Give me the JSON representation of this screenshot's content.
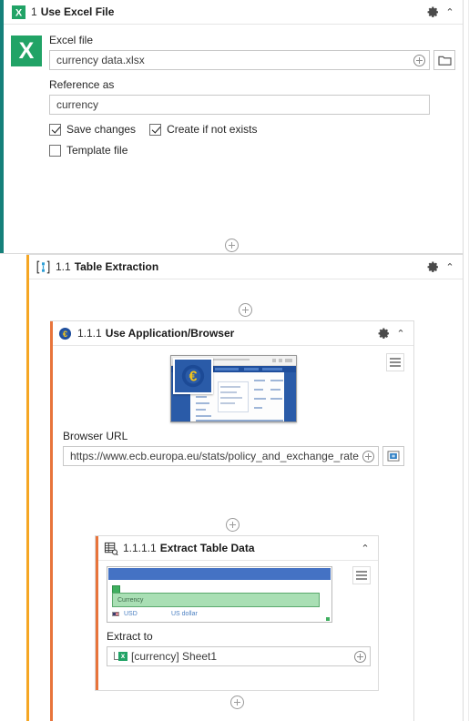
{
  "workflow": {
    "activities": [
      {
        "number": "1",
        "title": "Use Excel File",
        "icon": "excel-icon",
        "rail_color": "#15807a",
        "fields": {
          "excel_file_label": "Excel file",
          "excel_file_value": "currency data.xlsx",
          "reference_as_label": "Reference as",
          "reference_as_value": "currency"
        },
        "checkboxes": [
          {
            "label": "Save changes",
            "checked": true
          },
          {
            "label": "Create if not exists",
            "checked": true
          },
          {
            "label": "Template file",
            "checked": false
          }
        ]
      },
      {
        "number": "1.1",
        "title": "Table Extraction",
        "icon": "table-extraction-icon",
        "rail_color": "#f5a623"
      },
      {
        "number": "1.1.1",
        "title": "Use Application/Browser",
        "icon": "browser-euro-icon",
        "rail_color": "#e8743b",
        "fields": {
          "browser_url_label": "Browser URL",
          "browser_url_value": "https://www.ecb.europa.eu/stats/policy_and_exchange_rates ..."
        }
      },
      {
        "number": "1.1.1.1",
        "title": "Extract Table Data",
        "icon": "extract-table-icon",
        "rail_color": "#e8743b",
        "fields": {
          "extract_to_label": "Extract to",
          "extract_to_value": "[currency] Sheet1"
        },
        "table_preview": {
          "selected_column": "Currency",
          "sample_row": {
            "code": "USD",
            "name": "US dollar"
          }
        }
      }
    ]
  },
  "icons": {
    "gear": "gear-icon",
    "collapse": "⌃",
    "plus": "+",
    "menu": "hamburger-icon",
    "folder": "folder-icon",
    "screenshot": "screenshot-icon",
    "excel_letter": "X"
  },
  "colors": {
    "excel_green": "#21a366",
    "rail_teal": "#15807a",
    "rail_amber": "#f5a623",
    "rail_orange": "#e8743b",
    "table_header_blue": "#4472c4",
    "selection_green": "#a9dfb4"
  }
}
